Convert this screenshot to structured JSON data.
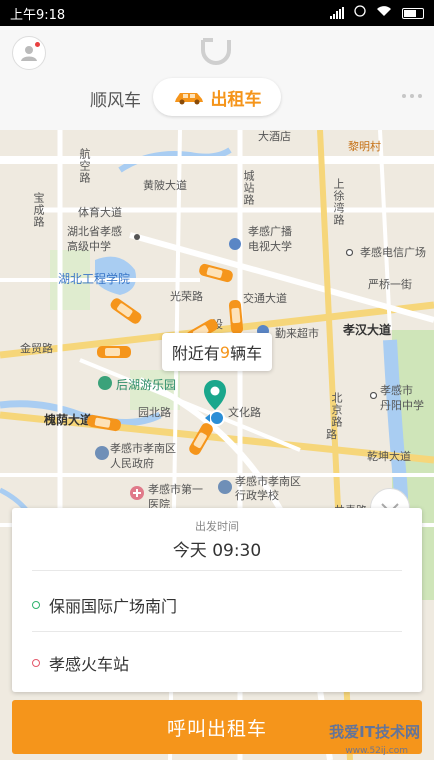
{
  "status_bar": {
    "time": "上午9:18"
  },
  "header": {
    "tabs": [
      {
        "label": "顺风车"
      },
      {
        "label": "出租车"
      }
    ]
  },
  "map": {
    "labels": {
      "l1": "大酒店",
      "l2": "黎明村",
      "l3": "航空路",
      "l4": "黄陂大道",
      "l5": "城站路",
      "l6": "上徐湾路",
      "l7": "宝成路",
      "l8": "体育大道",
      "l9": "湖北省孝感",
      "l10": "高级中学",
      "l11": "孝感广播",
      "l12": "电视大学",
      "l13": "孝感电信广场",
      "l14": "湖北工程学院",
      "l15": "交通大道",
      "l16": "严桥一街",
      "l17": "光荣路",
      "l18": "勤来超市",
      "l19": "孝汉大道",
      "l20": "金贸路",
      "l21": "后湖游乐园",
      "l22": "北京路",
      "l23": "孝感市",
      "l24": "丹阳中学",
      "l25": "槐荫大道",
      "l26": "园北路",
      "l27": "文化路",
      "l28": "孝感市孝南区",
      "l29": "人民政府",
      "l30": "乾坤大道",
      "l31": "孝感市孝南区",
      "l32": "行政学校",
      "l33": "孝感市第一",
      "l34": "医院",
      "l35": "共青路",
      "l36": "设",
      "l37": "路"
    },
    "nearby_prefix": "附近有",
    "nearby_count": "9",
    "nearby_suffix": "辆车"
  },
  "order": {
    "depart_label": "出发时间",
    "depart_time": "今天 09:30",
    "from": "保丽国际广场南门",
    "to": "孝感火车站",
    "from_color": "#2fb36d",
    "to_color": "#e4586b"
  },
  "call_button": "呼叫出租车",
  "watermark": {
    "main": "我爱IT技术网",
    "sub": "www.52ij.com"
  },
  "colors": {
    "accent": "#f5951b",
    "water": "#a9cdf2",
    "park": "#cfe5b9"
  }
}
